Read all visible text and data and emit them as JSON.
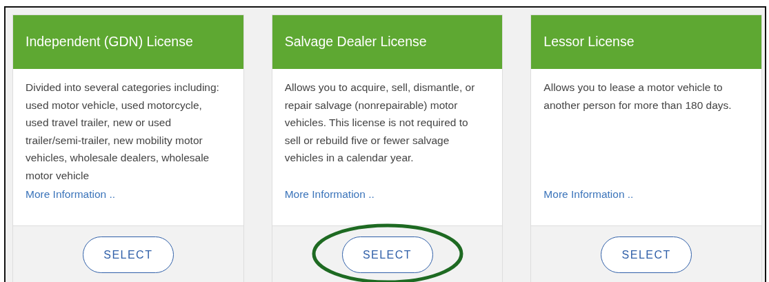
{
  "cards": [
    {
      "title": "Independent (GDN) License",
      "description": "Divided into several categories including: used motor vehicle, used motorcycle, used travel trailer, new or used trailer/semi-trailer, new mobility motor vehicles, wholesale dealers, wholesale motor vehicle",
      "link": "More Information ..",
      "button": "SELECT",
      "circled": false
    },
    {
      "title": "Salvage Dealer License",
      "description": "Allows you to acquire, sell, dismantle, or repair salvage (nonrepairable) motor vehicles. This license is not required to sell or rebuild five or fewer salvage vehicles in a calendar year.",
      "link": "More Information ..",
      "button": "SELECT",
      "circled": true
    },
    {
      "title": "Lessor License",
      "description": "Allows you to lease a motor vehicle to another person for more than 180 days.",
      "link": "More Information ..",
      "button": "SELECT",
      "circled": false
    }
  ]
}
